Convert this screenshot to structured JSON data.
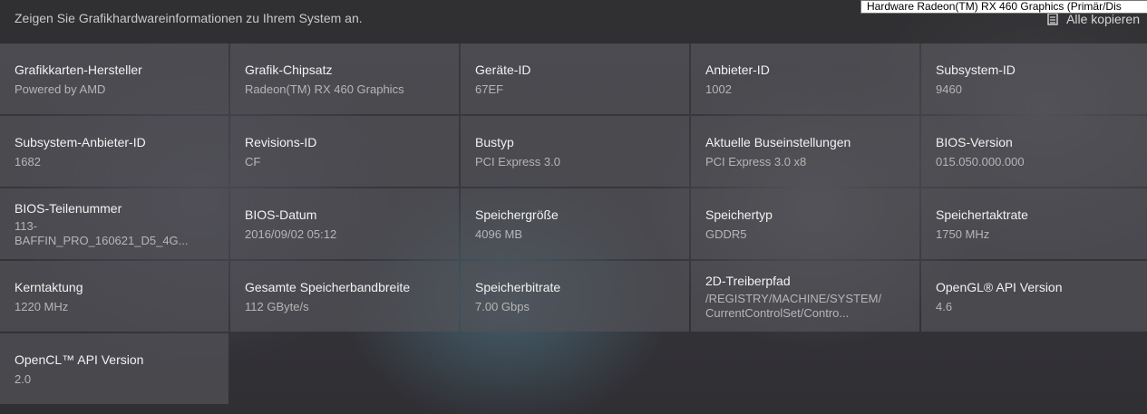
{
  "header": {
    "description": "Zeigen Sie Grafikhardwareinformationen zu Ihrem System an.",
    "copy_all_label": "Alle kopieren",
    "copy_icon": "copy-icon"
  },
  "tooltip": {
    "text": "Hardware Radeon(TM) RX 460 Graphics (Primär/Dis"
  },
  "info_cells": [
    {
      "label": "Grafikkarten-Hersteller",
      "value": "Powered by AMD"
    },
    {
      "label": "Grafik-Chipsatz",
      "value": "Radeon(TM) RX 460 Graphics"
    },
    {
      "label": "Geräte-ID",
      "value": "67EF"
    },
    {
      "label": "Anbieter-ID",
      "value": "1002"
    },
    {
      "label": "Subsystem-ID",
      "value": "9460"
    },
    {
      "label": "Subsystem-Anbieter-ID",
      "value": "1682"
    },
    {
      "label": "Revisions-ID",
      "value": "CF"
    },
    {
      "label": "Bustyp",
      "value": "PCI Express 3.0"
    },
    {
      "label": "Aktuelle Buseinstellungen",
      "value": "PCI Express 3.0 x8"
    },
    {
      "label": "BIOS-Version",
      "value": "015.050.000.000"
    },
    {
      "label": "BIOS-Teilenummer",
      "value": "113-\nBAFFIN_PRO_160621_D5_4G..."
    },
    {
      "label": "BIOS-Datum",
      "value": "2016/09/02 05:12"
    },
    {
      "label": "Speichergröße",
      "value": "4096 MB"
    },
    {
      "label": "Speichertyp",
      "value": "GDDR5"
    },
    {
      "label": "Speichertaktrate",
      "value": "1750 MHz"
    },
    {
      "label": "Kerntaktung",
      "value": "1220 MHz"
    },
    {
      "label": "Gesamte Speicherbandbreite",
      "value": "112 GByte/s"
    },
    {
      "label": "Speicherbitrate",
      "value": "7.00 Gbps"
    },
    {
      "label": "2D-Treiberpfad",
      "value": "/REGISTRY/MACHINE/SYSTEM/\nCurrentControlSet/Contro..."
    },
    {
      "label": "OpenGL® API Version",
      "value": "4.6"
    },
    {
      "label": "OpenCL™ API Version",
      "value": "2.0"
    }
  ]
}
